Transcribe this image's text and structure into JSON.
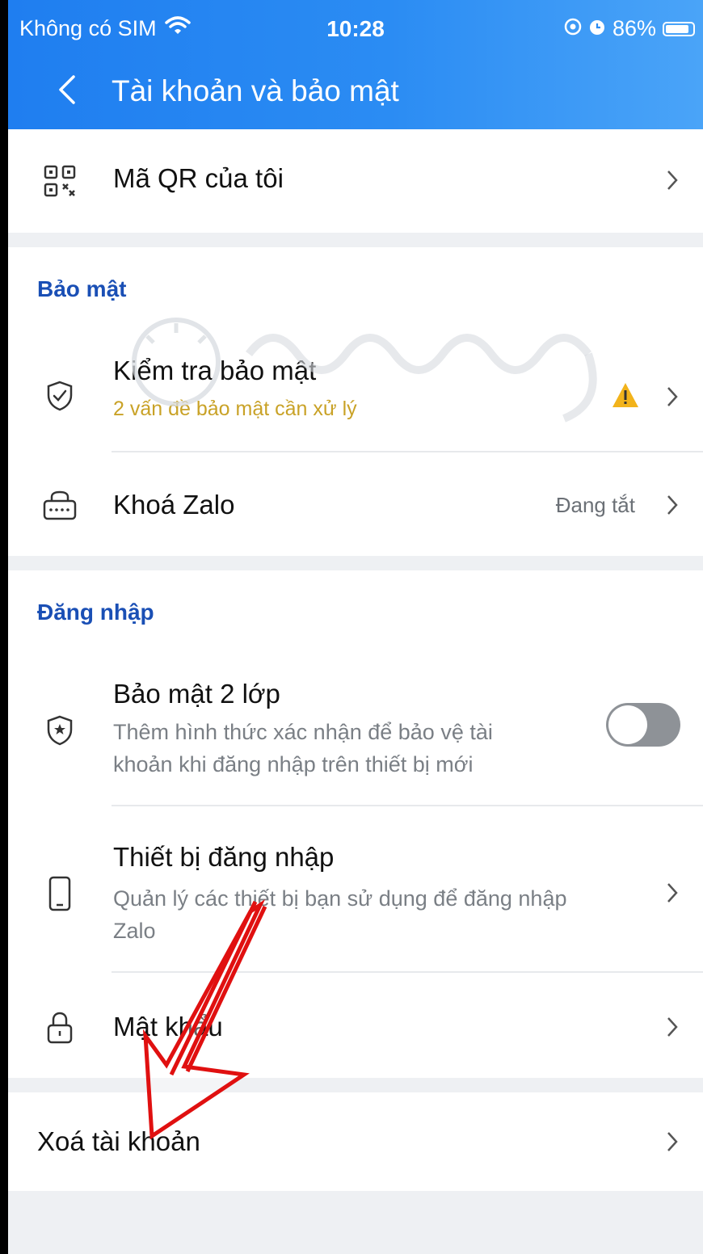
{
  "status_bar": {
    "carrier": "Không có SIM",
    "time": "10:28",
    "battery": "86%",
    "battery_level": 0.86
  },
  "nav": {
    "title": "Tài khoản và bảo mật"
  },
  "qr": {
    "label": "Mã QR của tôi"
  },
  "security": {
    "section_label": "Bảo mật",
    "check_title": "Kiểm tra bảo mật",
    "check_sub": "2 vấn đề bảo mật cần xử lý",
    "lock_title": "Khoá Zalo",
    "lock_status": "Đang tắt"
  },
  "login": {
    "section_label": "Đăng nhập",
    "twofa_title": "Bảo mật 2 lớp",
    "twofa_sub1": "Thêm hình thức xác nhận để bảo vệ tài",
    "twofa_sub2": "khoản khi đăng nhập trên thiết bị mới",
    "twofa_enabled": false,
    "devices_title": "Thiết bị đăng nhập",
    "devices_sub1": "Quản lý các thiết bị bạn sử dụng để đăng nhập",
    "devices_sub2": "Zalo",
    "password_title": "Mật khẩu"
  },
  "delete": {
    "label": "Xoá tài khoản"
  },
  "colors": {
    "header": "#2b8cf3",
    "section_label": "#1a4fb5",
    "warning": "#c9a227",
    "arrow": "#e01010"
  }
}
